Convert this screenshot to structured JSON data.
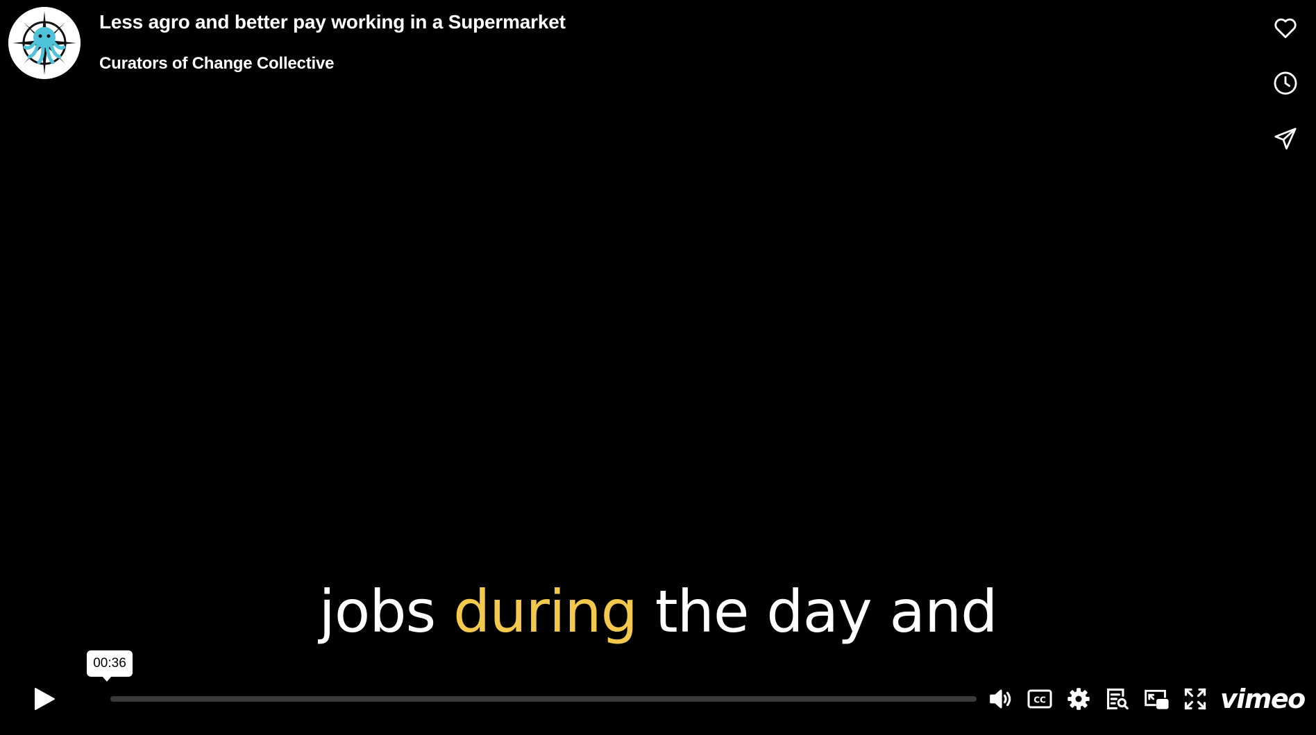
{
  "header": {
    "title": "Less agro and better pay working in a Supermarket",
    "channel": "Curators of Change Collective",
    "avatar_icon": "octopus-compass-logo"
  },
  "side_actions": [
    {
      "name": "like",
      "icon": "heart-icon"
    },
    {
      "name": "watch-later",
      "icon": "clock-icon"
    },
    {
      "name": "share",
      "icon": "paper-plane-icon"
    }
  ],
  "caption": {
    "before": "jobs ",
    "highlight": "during",
    "after": " the day and",
    "highlight_color": "#f2c94c"
  },
  "controls": {
    "play_icon": "play-icon",
    "hover_time": "00:36",
    "progress_fraction": 0.0,
    "right_icons": [
      "volume-icon",
      "cc-icon",
      "gear-icon",
      "transcript-icon",
      "pip-icon",
      "fullscreen-icon"
    ],
    "brand": "vimeo"
  },
  "colors": {
    "background": "#000000",
    "foreground": "#ffffff",
    "track": "#3a3a3a",
    "logo_accent": "#4fc3d9"
  }
}
